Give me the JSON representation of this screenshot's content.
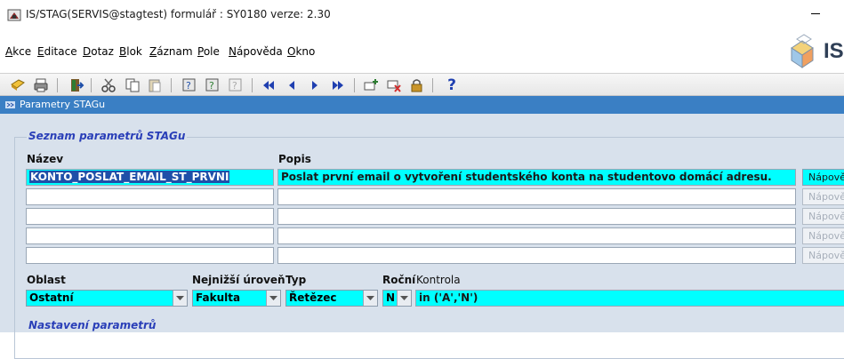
{
  "window": {
    "title": "IS/STAG(SERVIS@stagtest) formulář : SY0180 verze: 2.30"
  },
  "menu": [
    {
      "label": "Akce",
      "accel": "A"
    },
    {
      "label": "Editace",
      "accel": "E"
    },
    {
      "label": "Dotaz",
      "accel": "D"
    },
    {
      "label": "Blok",
      "accel": "B"
    },
    {
      "label": "Záznam",
      "accel": "Z"
    },
    {
      "label": "Pole",
      "accel": "P"
    },
    {
      "label": "Nápověda",
      "accel": "N"
    },
    {
      "label": "Okno",
      "accel": "O"
    }
  ],
  "logo": {
    "text": "IS"
  },
  "toolbar": {
    "icons": [
      "save-icon",
      "print-icon",
      "exit-icon",
      "cut-icon",
      "copy-icon",
      "paste-icon",
      "enter-query-icon",
      "execute-query-icon",
      "cancel-query-icon",
      "first-record-icon",
      "previous-record-icon",
      "next-record-icon",
      "last-record-icon",
      "insert-record-icon",
      "delete-record-icon",
      "lock-record-icon",
      "help-icon"
    ],
    "help_label": "?"
  },
  "inner_window": {
    "title": "Parametry STAGu"
  },
  "section1": {
    "title": "Seznam parametrů STAGu",
    "col_nazev": "Název",
    "col_popis": "Popis",
    "button_label": "Nápověda",
    "rows": [
      {
        "nazev": "KONTO_POSLAT_EMAIL_ST_PRVNI",
        "popis": "Poslat první email o vytvoření studentského konta na studentovo domácí adresu."
      },
      {
        "nazev": "",
        "popis": ""
      },
      {
        "nazev": "",
        "popis": ""
      },
      {
        "nazev": "",
        "popis": ""
      },
      {
        "nazev": "",
        "popis": ""
      }
    ]
  },
  "detail": {
    "oblast_label": "Oblast",
    "oblast_value": "Ostatní",
    "uroven_label": "Nejnižší úroveň",
    "uroven_value": "Fakulta",
    "typ_label": "Typ",
    "typ_value": "Řetězec",
    "rocni_label": "Roční",
    "rocni_value": "N",
    "kontrola_label": "Kontrola",
    "kontrola_value": "in ('A','N')"
  },
  "section2": {
    "title": "Nastavení parametrů"
  },
  "colors": {
    "active_field": "#00ffff",
    "form_background": "#d8e1ec",
    "window_strip": "#3a7fc4",
    "section_title": "#2a3fb8"
  }
}
